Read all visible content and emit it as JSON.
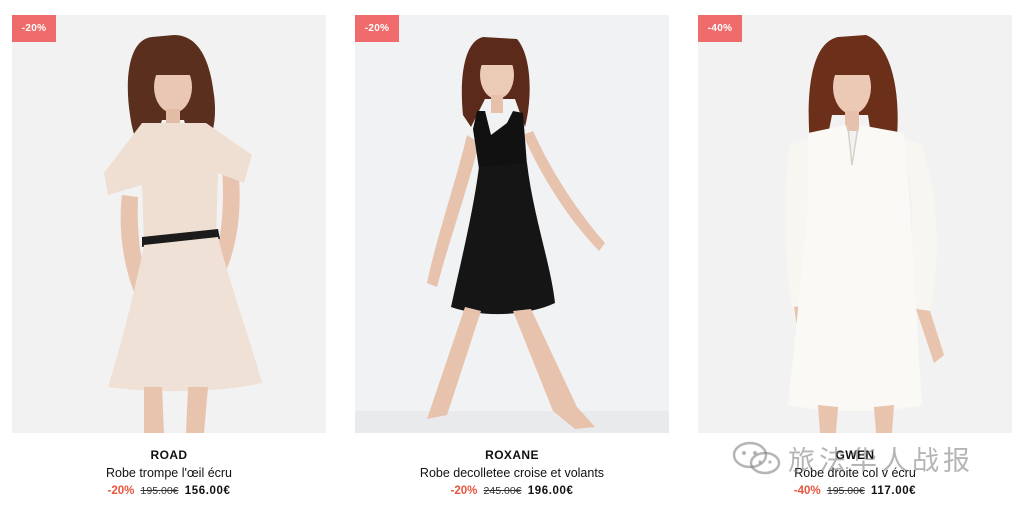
{
  "products": [
    {
      "badge": "-20%",
      "name": "ROAD",
      "description": "Robe trompe l'œil écru",
      "discount": "-20%",
      "old_price": "195.00€",
      "new_price": "156.00€"
    },
    {
      "badge": "-20%",
      "name": "ROXANE",
      "description": "Robe decolletee croise et volants",
      "discount": "-20%",
      "old_price": "245.00€",
      "new_price": "196.00€"
    },
    {
      "badge": "-40%",
      "name": "GWEN",
      "description": "Robe droite col v écru",
      "discount": "-40%",
      "old_price": "195.00€",
      "new_price": "117.00€"
    }
  ],
  "watermark": {
    "text": "旅法华人战报",
    "icon": "wechat-icon"
  },
  "colors": {
    "badge_bg": "#f06b6b",
    "discount_text": "#e8553c",
    "photo_bg": "#f2f2f2"
  }
}
